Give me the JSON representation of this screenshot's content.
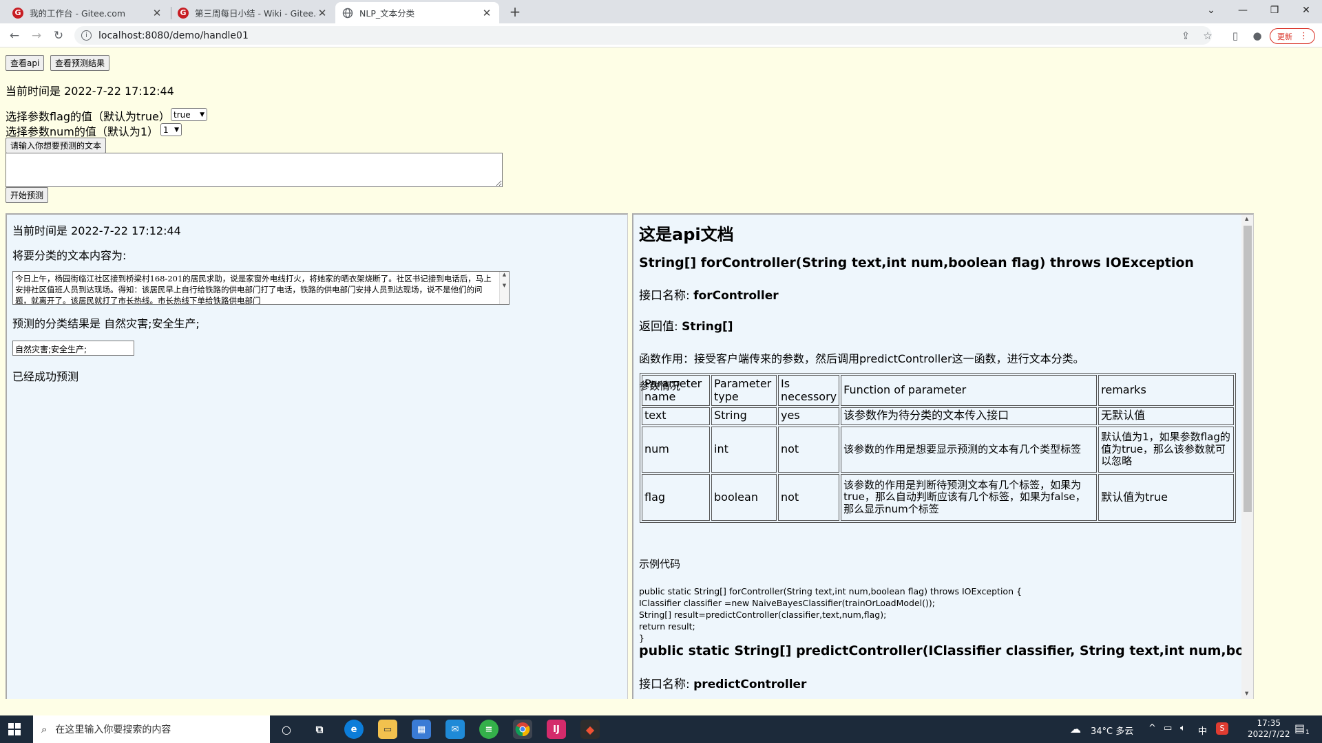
{
  "browser": {
    "tabs": [
      {
        "title": "我的工作台 - Gitee.com"
      },
      {
        "title": "第三周每日小结 - Wiki - Gitee.c"
      },
      {
        "title": "NLP_文本分类"
      }
    ],
    "url": "localhost:8080/demo/handle01",
    "update_label": "更新"
  },
  "controls": {
    "view_api_button": "查看api",
    "view_result_button": "查看预测结果",
    "current_time": "当前时间是 2022-7-22 17:12:44",
    "flag_label": "选择参数flag的值（默认为true）",
    "flag_value": "true",
    "num_label": "选择参数num的值（默认为1）",
    "num_value": "1",
    "input_prompt_button": "请输入你想要预测的文本",
    "text_input_value": "",
    "start_button": "开始预测"
  },
  "result_panel": {
    "time": "当前时间是 2022-7-22 17:12:44",
    "text_label": "将要分类的文本内容为:",
    "text_content": "今日上午，杨园街临江社区接到桥梁村168-201的居民求助，说是家窗外电线打火，将她家的晒衣架烧断了。社区书记接到电话后，马上安排社区值班人员到达现场。得知：该居民早上自行给铁路的供电部门打了电话，铁路的供电部门安排人员到达现场，说不是他们的问题，就离开了。该居民就打了市长热线。市长热线下单给铁路供电部门",
    "result_label": "预测的分类结果是 自然灾害;安全生产;",
    "result_value": "自然灾害;安全生产;",
    "status": "已经成功预测"
  },
  "api_doc": {
    "title": "这是api文档",
    "sig1": "String[] forController(String text,int num,boolean flag) throws IOException",
    "iface_label": "接口名称:",
    "iface_name": "forController",
    "return_label": "返回值:",
    "return_value": "String[]",
    "function_desc": "函数作用：接受客户端传来的参数，然后调用predictController这一函数，进行文本分类。",
    "params_caption": "参数情况",
    "table_headers": [
      "Parameter name",
      "Parameter type",
      "Is necessory",
      "Function of parameter",
      "remarks"
    ],
    "table_rows": [
      [
        "text",
        "String",
        "yes",
        "该参数作为待分类的文本传入接口",
        "无默认值"
      ],
      [
        "num",
        "int",
        "not",
        "该参数的作用是想要显示预测的文本有几个类型标签",
        "默认值为1，如果参数flag的值为true，那么该参数就可以忽略"
      ],
      [
        "flag",
        "boolean",
        "not",
        "该参数的作用是判断待预测文本有几个标签，如果为true，那么自动判断应该有几个标签，如果为false，那么显示num个标签",
        "默认值为true"
      ]
    ],
    "example_caption": "示例代码",
    "code_lines": [
      "public static String[] forController(String text,int num,boolean flag) throws IOException {",
      "IClassifier classifier =new NaiveBayesClassifier(trainOrLoadModel());",
      "String[] result=predictController(classifier,text,num,flag);",
      "return result;",
      "}"
    ],
    "sig2": "public static String[] predictController(IClassifier classifier, String text,int num,boolean flag)",
    "iface2_label": "接口名称:",
    "iface2_name": "predictController"
  },
  "taskbar": {
    "search_placeholder": "在这里输入你要搜索的内容",
    "weather": "34°C 多云",
    "ime": "中",
    "time": "17:35",
    "date": "2022/7/22",
    "notification_count": "1"
  }
}
